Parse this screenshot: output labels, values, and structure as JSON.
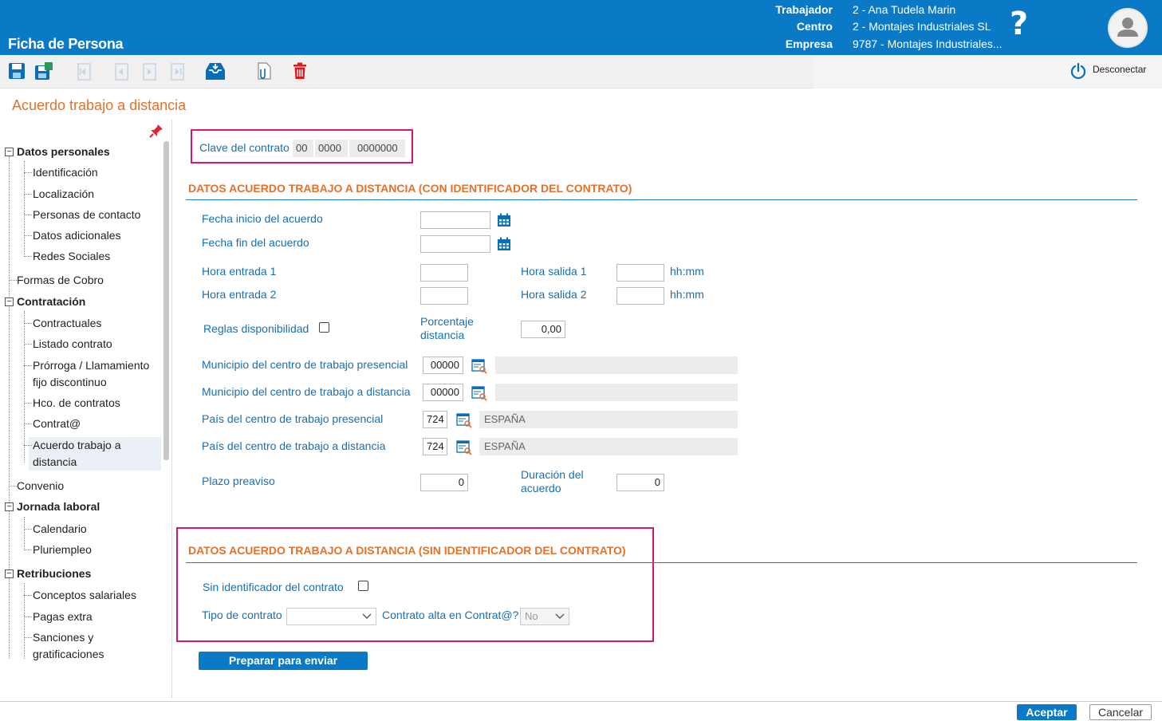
{
  "header": {
    "app_title": "Ficha de Persona",
    "trabajador_label": "Trabajador",
    "trabajador_value": "2 - Ana Tudela Marin",
    "centro_label": "Centro",
    "centro_value": "2 - Montajes Industriales SL",
    "empresa_label": "Empresa",
    "empresa_value": "9787 - Montajes Industriales...",
    "help_icon": "?",
    "avatar_icon": "user-icon",
    "brand_color": "#0a7ac6"
  },
  "toolbar": {
    "buttons": [
      "save-icon",
      "save-all-icon",
      "first-record-icon",
      "previous-record-icon",
      "next-record-icon",
      "last-record-icon",
      "inbox-icon",
      "attachment-icon",
      "delete-icon"
    ],
    "disconnect_label": "Desconectar"
  },
  "page_title": "Acuerdo trabajo a distancia",
  "tree": {
    "datos_personales": "Datos personales",
    "identificacion": "Identificación",
    "localizacion": "Localización",
    "personas_contacto": "Personas de contacto",
    "datos_adicionales": "Datos adicionales",
    "redes_sociales": "Redes Sociales",
    "formas_cobro": "Formas de Cobro",
    "contratacion": "Contratación",
    "contractuales": "Contractuales",
    "listado_contrato": "Listado contrato",
    "prorroga_1": "Prórroga / Llamamiento",
    "prorroga_2": "fijo discontinuo",
    "hco_contratos": "Hco. de contratos",
    "contrata": "Contrat@",
    "acuerdo_1": "Acuerdo trabajo a",
    "acuerdo_2": "distancia",
    "convenio": "Convenio",
    "jornada_laboral": "Jornada laboral",
    "calendario": "Calendario",
    "pluriempleo": "Pluriempleo",
    "retribuciones": "Retribuciones",
    "conceptos_salariales": "Conceptos salariales",
    "pagas_extra": "Pagas extra",
    "sanciones_1": "Sanciones y",
    "sanciones_2": "gratificaciones"
  },
  "form": {
    "clave_label": "Clave del contrato",
    "clave_1": "00",
    "clave_2": "0000",
    "clave_3": "0000000",
    "section1_title": "DATOS ACUERDO TRABAJO A DISTANCIA (CON IDENTIFICADOR DEL CONTRATO)",
    "fecha_inicio_label": "Fecha inicio del acuerdo",
    "fecha_inicio_value": "",
    "fecha_fin_label": "Fecha fin del acuerdo",
    "fecha_fin_value": "",
    "hora_entrada1_label": "Hora entrada 1",
    "hora_entrada1_value": "",
    "hora_salida1_label": "Hora salida 1",
    "hora_salida1_value": "",
    "hora_entrada2_label": "Hora entrada 2",
    "hora_entrada2_value": "",
    "hora_salida2_label": "Hora salida 2",
    "hora_salida2_value": "",
    "hhmm": "hh:mm",
    "reglas_label": "Reglas disponibilidad",
    "porcentaje_label_1": "Porcentaje",
    "porcentaje_label_2": "distancia",
    "porcentaje_value": "0,00",
    "mun_presencial_label": "Municipio del centro de trabajo presencial",
    "mun_presencial_code": "00000",
    "mun_presencial_desc": "",
    "mun_distancia_label": "Municipio del centro de trabajo a distancia",
    "mun_distancia_code": "00000",
    "mun_distancia_desc": "",
    "pais_presencial_label": "País del centro de trabajo presencial",
    "pais_presencial_code": "724",
    "pais_presencial_desc": "ESPAÑA",
    "pais_distancia_label": "País del centro de trabajo a distancia",
    "pais_distancia_code": "724",
    "pais_distancia_desc": "ESPAÑA",
    "plazo_label": "Plazo preaviso",
    "plazo_value": "0",
    "duracion_label_1": "Duración del",
    "duracion_label_2": "acuerdo",
    "duracion_value": "0",
    "section2_title": "DATOS ACUERDO TRABAJO A DISTANCIA (SIN IDENTIFICADOR DEL CONTRATO)",
    "sin_identificador_label": "Sin identificador del contrato",
    "tipo_contrato_label": "Tipo de contrato",
    "tipo_contrato_value": "",
    "contrato_alta_label": "Contrato alta en Contrat@?",
    "contrato_alta_value": "No",
    "preparar_button": "Preparar para enviar"
  },
  "footer": {
    "aceptar": "Aceptar",
    "cancelar": "Cancelar"
  },
  "colors": {
    "accent_orange": "#e2722b",
    "label_blue": "#1a6fb0",
    "highlight_pink": "#d6186c"
  }
}
